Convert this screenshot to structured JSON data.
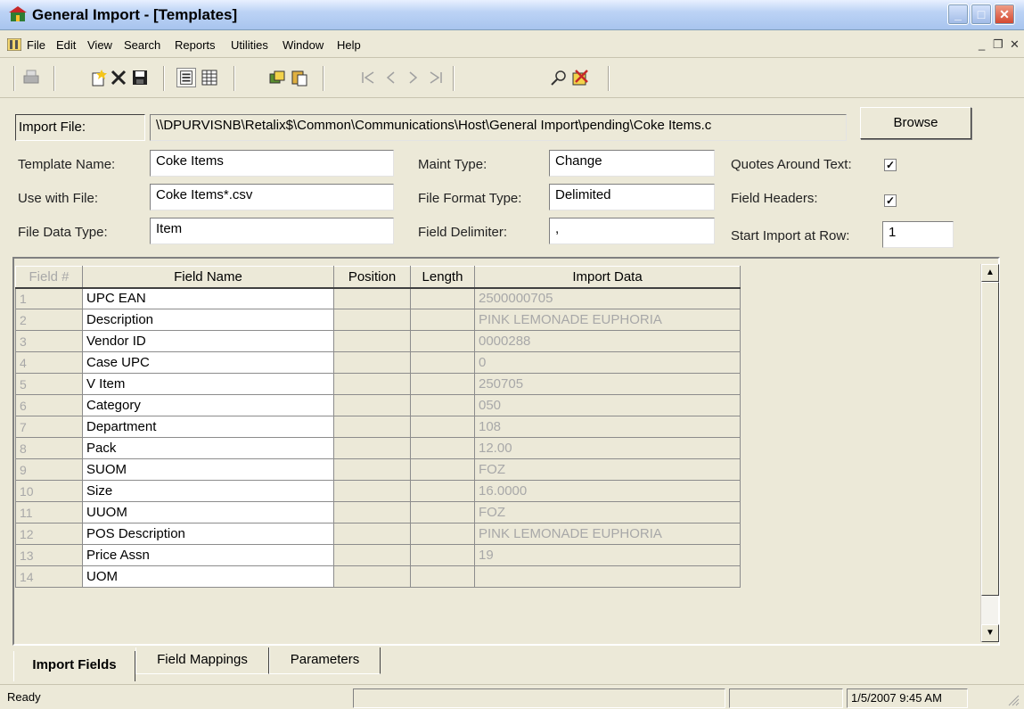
{
  "window": {
    "title": "General Import - [Templates]"
  },
  "menu": [
    "File",
    "Edit",
    "View",
    "Search",
    "Reports",
    "Utilities",
    "Window",
    "Help"
  ],
  "form": {
    "import_file_label": "Import File:",
    "import_file_value": "\\\\DPURVISNB\\Retalix$\\Common\\Communications\\Host\\General Import\\pending\\Coke Items.c",
    "browse_label": "Browse",
    "template_name_label": "Template Name:",
    "template_name_value": "Coke Items",
    "use_with_file_label": "Use with File:",
    "use_with_file_value": "Coke Items*.csv",
    "file_data_type_label": "File Data Type:",
    "file_data_type_value": "Item",
    "maint_type_label": "Maint Type:",
    "maint_type_value": "Change",
    "file_format_type_label": "File Format Type:",
    "file_format_type_value": "Delimited",
    "field_delimiter_label": "Field Delimiter:",
    "field_delimiter_value": ",",
    "quotes_around_text_label": "Quotes Around Text:",
    "quotes_around_text_checked": true,
    "field_headers_label": "Field Headers:",
    "field_headers_checked": true,
    "start_import_row_label": "Start Import at Row:",
    "start_import_row_value": "1"
  },
  "grid": {
    "columns": [
      "Field #",
      "Field Name",
      "Position",
      "Length",
      "Import Data"
    ],
    "rows": [
      {
        "num": "1",
        "name": "UPC EAN",
        "position": "",
        "length": "",
        "data": "2500000705"
      },
      {
        "num": "2",
        "name": "Description",
        "position": "",
        "length": "",
        "data": "PINK LEMONADE EUPHORIA"
      },
      {
        "num": "3",
        "name": "Vendor ID",
        "position": "",
        "length": "",
        "data": "0000288"
      },
      {
        "num": "4",
        "name": "Case UPC",
        "position": "",
        "length": "",
        "data": "0"
      },
      {
        "num": "5",
        "name": "V Item",
        "position": "",
        "length": "",
        "data": "250705"
      },
      {
        "num": "6",
        "name": "Category",
        "position": "",
        "length": "",
        "data": "050"
      },
      {
        "num": "7",
        "name": "Department",
        "position": "",
        "length": "",
        "data": "108"
      },
      {
        "num": "8",
        "name": "Pack",
        "position": "",
        "length": "",
        "data": "12.00"
      },
      {
        "num": "9",
        "name": "SUOM",
        "position": "",
        "length": "",
        "data": "FOZ"
      },
      {
        "num": "10",
        "name": "Size",
        "position": "",
        "length": "",
        "data": "16.0000"
      },
      {
        "num": "11",
        "name": "UUOM",
        "position": "",
        "length": "",
        "data": "FOZ"
      },
      {
        "num": "12",
        "name": "POS Description",
        "position": "",
        "length": "",
        "data": "PINK LEMONADE EUPHORIA"
      },
      {
        "num": "13",
        "name": "Price Assn",
        "position": "",
        "length": "",
        "data": "19"
      },
      {
        "num": "14",
        "name": "UOM",
        "position": "",
        "length": "",
        "data": ""
      }
    ]
  },
  "tabs": [
    "Import Fields",
    "Field Mappings",
    "Parameters"
  ],
  "status": {
    "text": "Ready",
    "datetime": "1/5/2007 9:45 AM"
  },
  "icons": {
    "app": "app-icon",
    "print": "print-icon",
    "new": "new-icon",
    "delete": "delete-icon",
    "save": "save-icon",
    "form_view": "form-view-icon",
    "grid_view": "grid-view-icon",
    "copy": "copy-icon",
    "paste": "paste-icon",
    "first": "first-record-icon",
    "prev": "prev-record-icon",
    "next": "next-record-icon",
    "last": "last-record-icon",
    "find": "find-icon",
    "exit": "exit-icon"
  }
}
